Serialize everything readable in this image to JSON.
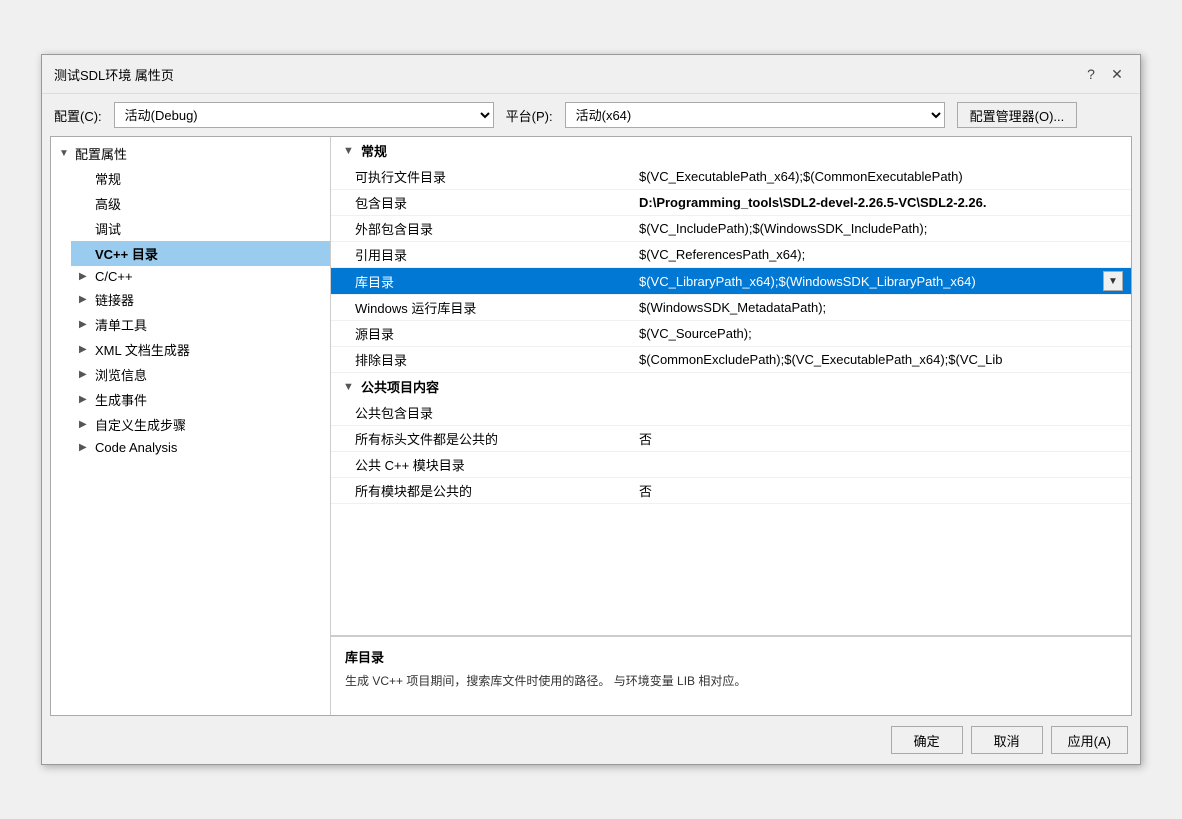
{
  "dialog": {
    "title": "测试SDL环境 属性页",
    "help_btn": "?",
    "close_btn": "✕"
  },
  "toolbar": {
    "config_label": "配置(C):",
    "config_value": "活动(Debug)",
    "platform_label": "平台(P):",
    "platform_value": "活动(x64)",
    "manager_btn": "配置管理器(O)..."
  },
  "left_tree": {
    "root_label": "配置属性",
    "items": [
      {
        "label": "常规",
        "indent": 1,
        "selected": false,
        "expanded": false,
        "has_children": false
      },
      {
        "label": "高级",
        "indent": 1,
        "selected": false,
        "expanded": false,
        "has_children": false
      },
      {
        "label": "调试",
        "indent": 1,
        "selected": false,
        "expanded": false,
        "has_children": false
      },
      {
        "label": "VC++ 目录",
        "indent": 1,
        "selected": true,
        "expanded": false,
        "has_children": false
      },
      {
        "label": "C/C++",
        "indent": 1,
        "selected": false,
        "expanded": false,
        "has_children": true
      },
      {
        "label": "链接器",
        "indent": 1,
        "selected": false,
        "expanded": false,
        "has_children": true
      },
      {
        "label": "清单工具",
        "indent": 1,
        "selected": false,
        "expanded": false,
        "has_children": true
      },
      {
        "label": "XML 文档生成器",
        "indent": 1,
        "selected": false,
        "expanded": false,
        "has_children": true
      },
      {
        "label": "浏览信息",
        "indent": 1,
        "selected": false,
        "expanded": false,
        "has_children": true
      },
      {
        "label": "生成事件",
        "indent": 1,
        "selected": false,
        "expanded": false,
        "has_children": true
      },
      {
        "label": "自定义生成步骤",
        "indent": 1,
        "selected": false,
        "expanded": false,
        "has_children": true
      },
      {
        "label": "Code Analysis",
        "indent": 1,
        "selected": false,
        "expanded": false,
        "has_children": true
      }
    ]
  },
  "right_panel": {
    "sections": [
      {
        "label": "常规",
        "collapsed": false,
        "properties": [
          {
            "name": "可执行文件目录",
            "value": "$(VC_ExecutablePath_x64);$(CommonExecutablePath)",
            "selected": false,
            "bold": false
          },
          {
            "name": "包含目录",
            "value": "D:\\Programming_tools\\SDL2-devel-2.26.5-VC\\SDL2-2.26.",
            "selected": false,
            "bold": true
          },
          {
            "name": "外部包含目录",
            "value": "$(VC_IncludePath);$(WindowsSDK_IncludePath);",
            "selected": false,
            "bold": false
          },
          {
            "name": "引用目录",
            "value": "$(VC_ReferencesPath_x64);",
            "selected": false,
            "bold": false
          },
          {
            "name": "库目录",
            "value": "$(VC_LibraryPath_x64);$(WindowsSDK_LibraryPath_x64)",
            "selected": true,
            "bold": false,
            "has_dropdown": true
          },
          {
            "name": "Windows 运行库目录",
            "value": "$(WindowsSDK_MetadataPath);",
            "selected": false,
            "bold": false
          },
          {
            "name": "源目录",
            "value": "$(VC_SourcePath);",
            "selected": false,
            "bold": false
          },
          {
            "name": "排除目录",
            "value": "$(CommonExcludePath);$(VC_ExecutablePath_x64);$(VC_Lib",
            "selected": false,
            "bold": false
          }
        ]
      },
      {
        "label": "公共项目内容",
        "collapsed": false,
        "properties": [
          {
            "name": "公共包含目录",
            "value": "",
            "selected": false,
            "bold": false
          },
          {
            "name": "所有标头文件都是公共的",
            "value": "否",
            "selected": false,
            "bold": false
          },
          {
            "name": "公共 C++ 模块目录",
            "value": "",
            "selected": false,
            "bold": false
          },
          {
            "name": "所有模块都是公共的",
            "value": "否",
            "selected": false,
            "bold": false
          }
        ]
      }
    ],
    "description": {
      "title": "库目录",
      "text": "生成 VC++ 项目期间，搜索库文件时使用的路径。 与环境变量 LIB 相对应。"
    }
  },
  "footer": {
    "ok_label": "确定",
    "cancel_label": "取消",
    "apply_label": "应用(A)"
  }
}
